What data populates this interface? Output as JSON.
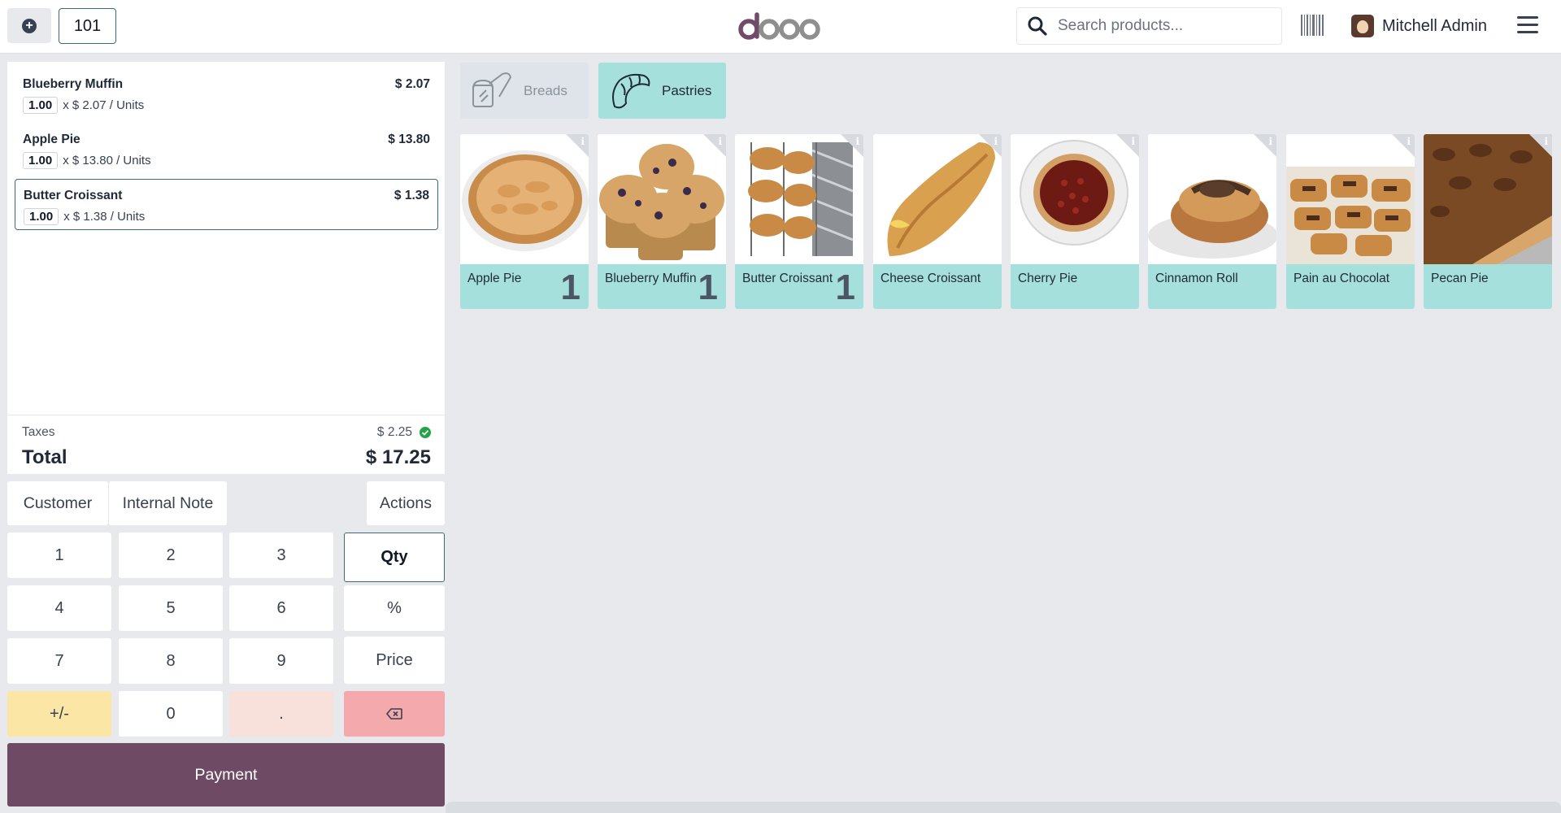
{
  "header": {
    "table_number": "101",
    "logo_text": "odoo",
    "search_placeholder": "Search products...",
    "user_name": "Mitchell Admin"
  },
  "order": {
    "lines": [
      {
        "name": "Blueberry Muffin",
        "price": "$ 2.07",
        "qty": "1.00",
        "unit_detail": "x $ 2.07 / Units",
        "selected": false
      },
      {
        "name": "Apple Pie",
        "price": "$ 13.80",
        "qty": "1.00",
        "unit_detail": "x $ 13.80 / Units",
        "selected": false
      },
      {
        "name": "Butter Croissant",
        "price": "$ 1.38",
        "qty": "1.00",
        "unit_detail": "x $ 1.38 / Units",
        "selected": true
      }
    ],
    "taxes_label": "Taxes",
    "taxes_value": "$ 2.25",
    "total_label": "Total",
    "total_value": "$ 17.25"
  },
  "controls": {
    "customer": "Customer",
    "internal_note": "Internal Note",
    "actions": "Actions"
  },
  "numpad": {
    "k1": "1",
    "k2": "2",
    "k3": "3",
    "k4": "4",
    "k5": "5",
    "k6": "6",
    "k7": "7",
    "k8": "8",
    "k9": "9",
    "sign": "+/-",
    "k0": "0",
    "dot": ".",
    "qty": "Qty",
    "percent": "%",
    "price": "Price",
    "active_mode": "Qty"
  },
  "payment_label": "Payment",
  "categories": [
    {
      "label": "Breads",
      "icon": "bread-icon",
      "active": false
    },
    {
      "label": "Pastries",
      "icon": "croissant-icon",
      "active": true
    }
  ],
  "products": [
    {
      "name": "Apple Pie",
      "count": "1",
      "image": "apple-pie"
    },
    {
      "name": "Blueberry Muffin",
      "count": "1",
      "image": "blueberry-muffin"
    },
    {
      "name": "Butter Croissant",
      "count": "1",
      "image": "butter-croissant"
    },
    {
      "name": "Cheese Croissant",
      "count": "",
      "image": "cheese-croissant"
    },
    {
      "name": "Cherry Pie",
      "count": "",
      "image": "cherry-pie"
    },
    {
      "name": "Cinnamon Roll",
      "count": "",
      "image": "cinnamon-roll"
    },
    {
      "name": "Pain au Chocolat",
      "count": "",
      "image": "pain-au-chocolat"
    },
    {
      "name": "Pecan Pie",
      "count": "",
      "image": "pecan-pie"
    }
  ],
  "colors": {
    "brand_purple": "#714B67",
    "accent_teal": "#a6e0dc",
    "active_border": "#3a6d72",
    "backspace": "#f4a9ac",
    "sign_key": "#fbe6a6",
    "tax_ok": "#22a34a"
  }
}
